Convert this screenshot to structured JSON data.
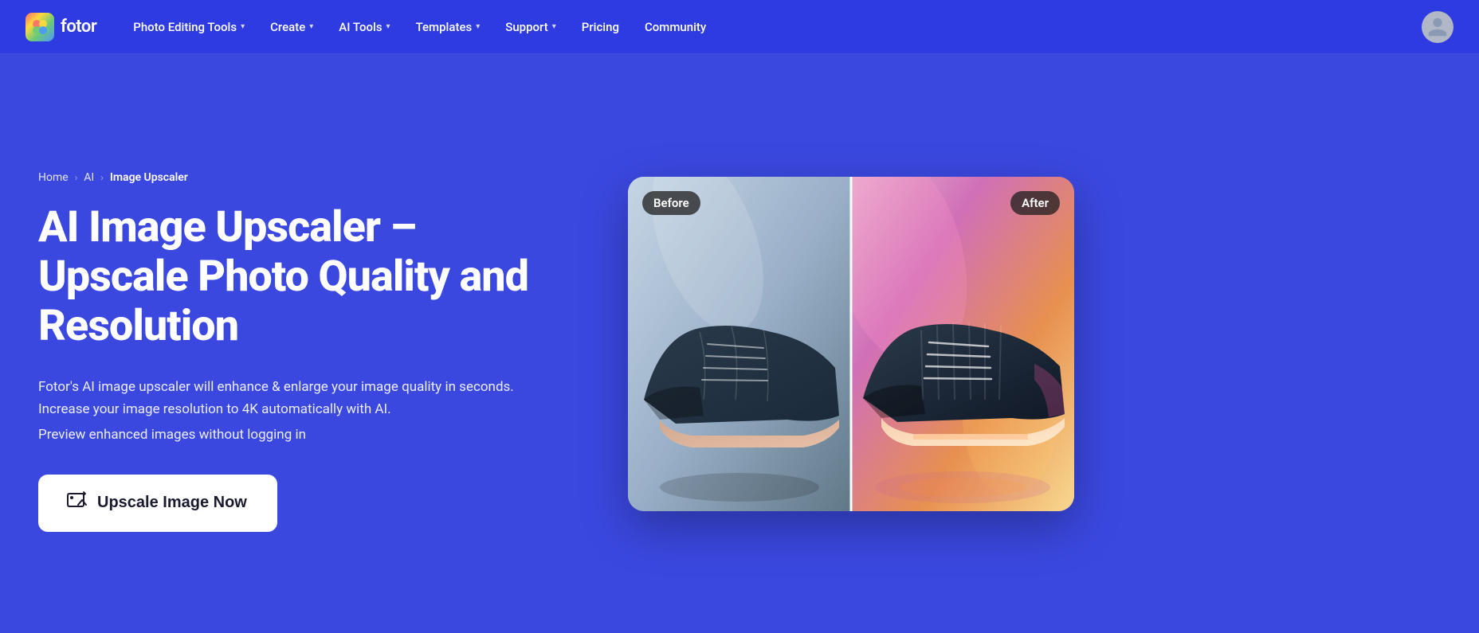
{
  "nav": {
    "logo_text": "fotor",
    "items": [
      {
        "id": "photo-editing-tools",
        "label": "Photo Editing Tools",
        "has_chevron": true
      },
      {
        "id": "create",
        "label": "Create",
        "has_chevron": true
      },
      {
        "id": "ai-tools",
        "label": "AI Tools",
        "has_chevron": true
      },
      {
        "id": "templates",
        "label": "Templates",
        "has_chevron": true
      },
      {
        "id": "support",
        "label": "Support",
        "has_chevron": true
      }
    ],
    "pricing_label": "Pricing",
    "community_label": "Community"
  },
  "breadcrumb": {
    "home": "Home",
    "ai": "AI",
    "current": "Image Upscaler"
  },
  "hero": {
    "heading_line1": "AI Image Upscaler –",
    "heading_line2": "Upscale Photo Quality and",
    "heading_line3": "Resolution",
    "description": "Fotor's AI image upscaler will enhance & enlarge your image quality in seconds. Increase your image resolution to 4K automatically with AI.",
    "description_sub": "Preview enhanced images without logging in",
    "cta_button": "Upscale Image Now"
  },
  "comparison": {
    "before_label": "Before",
    "after_label": "After"
  },
  "colors": {
    "nav_bg": "#2d3be0",
    "page_bg": "#3b48e0",
    "cta_bg": "#ffffff",
    "cta_text": "#1a1a2e"
  }
}
